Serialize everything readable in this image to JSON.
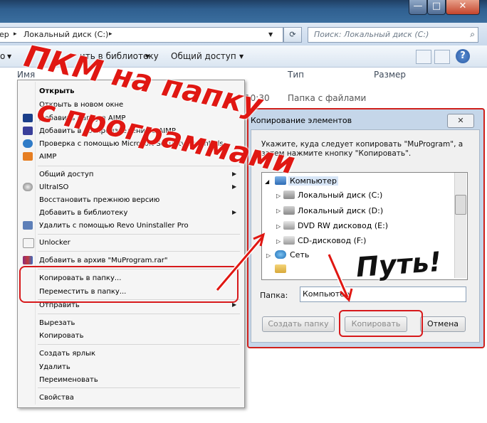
{
  "window": {
    "minimize_glyph": "—",
    "maximize_glyph": "□",
    "close_glyph": "✕"
  },
  "address": {
    "crumb_prefix": "ер",
    "crumb_sep": "▸",
    "path": "Локальный диск (C:)",
    "search_placeholder": "Поиск: Локальный диск (C:)"
  },
  "toolbar": {
    "organize_tail": "о",
    "add_to_library": "ить в библиотеку",
    "share": "Общий доступ"
  },
  "columns": {
    "name": "Имя",
    "type": "Тип",
    "size": "Размер"
  },
  "file_rows": [
    {
      "date": "10:30",
      "type": "Папка с файлами"
    }
  ],
  "context_menu": {
    "items": [
      {
        "label": "Открыть",
        "bold": true
      },
      {
        "label": "Открыть в новом окне"
      },
      {
        "label": "Добавить папку в AIMP"
      },
      {
        "label": "Добавить в воспроизведение в AIMP"
      },
      {
        "label": "Проверка с помощью Microsoft Security Essentials..."
      },
      {
        "label": "AIMP"
      },
      {
        "label": "Общий доступ"
      },
      {
        "label": "UltraISO"
      },
      {
        "label": "Восстановить прежнюю версию"
      },
      {
        "label": "Добавить в библиотеку"
      },
      {
        "label": "Удалить с помощью Revo Uninstaller Pro"
      },
      {
        "label": "Unlocker"
      },
      {
        "label": "Добавить в архив \"MuProgram.rar\""
      },
      {
        "label": "Копировать в папку..."
      },
      {
        "label": "Переместить в папку..."
      },
      {
        "label": "Отправить"
      },
      {
        "label": "Вырезать"
      },
      {
        "label": "Копировать"
      },
      {
        "label": "Создать ярлык"
      },
      {
        "label": "Удалить"
      },
      {
        "label": "Переименовать"
      },
      {
        "label": "Свойства"
      }
    ]
  },
  "dialog": {
    "title": "Копирование элементов",
    "close_glyph": "✕",
    "instructions": "Укажите, куда следует копировать \"MuProgram\", а затем нажмите кнопку \"Копировать\".",
    "tree": [
      {
        "label": "Компьютер",
        "expanded": true
      },
      {
        "label": "Локальный диск (C:)"
      },
      {
        "label": "Локальный диск (D:)"
      },
      {
        "label": "DVD RW дисковод (E:)"
      },
      {
        "label": "CD-дисковод (F:)"
      },
      {
        "label": "Сеть"
      }
    ],
    "folder_label": "Папка:",
    "folder_value": "Компьютер",
    "create_folder": "Создать папку",
    "copy": "Копировать",
    "cancel": "Отмена"
  },
  "annotations": {
    "top": "ПКМ на папку",
    "middle": "с программами",
    "right": "Путь!"
  },
  "colors": {
    "annotation_red": "#e01712",
    "title_bar": "#2f5f8f"
  }
}
